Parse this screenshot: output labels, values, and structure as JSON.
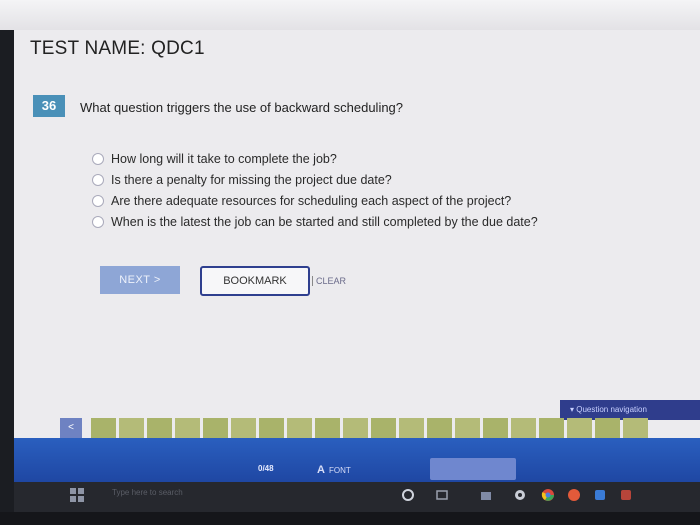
{
  "test": {
    "title": "TEST NAME:  QDC1"
  },
  "question": {
    "number": "36",
    "text": "What question triggers the use of backward scheduling?",
    "options": [
      "How long will it take to complete the job?",
      "Is there a penalty for missing the project due date?",
      "Are there adequate resources for scheduling each aspect of the project?",
      "When is the latest the job can be started and still completed by the due date?"
    ]
  },
  "actions": {
    "next_label": "NEXT >",
    "bookmark_label": "BOOKMARK",
    "clear_label": "CLEAR"
  },
  "navigation": {
    "question_navigation_label": "▾ Question navigation",
    "back_icon_label": "<",
    "answered_counter": "0/48",
    "font_label": "FONT",
    "font_icon": "A"
  },
  "taskbar": {
    "search_placeholder": "Type here to search"
  },
  "colors": {
    "accent": "#4a90b8",
    "next_button": "#8ea6d6",
    "bookmark_border": "#2f3f8f",
    "bottom_bar": "#2458b8",
    "tile": "#a9b36a"
  }
}
